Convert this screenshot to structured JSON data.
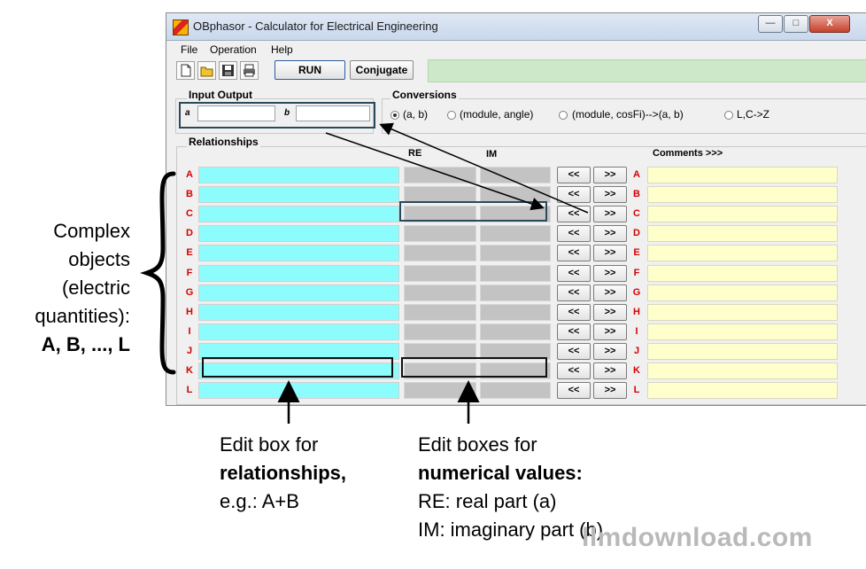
{
  "window": {
    "title": "OBphasor - Calculator for Electrical Engineering",
    "controls": {
      "minimize": "—",
      "maximize": "□",
      "close": "X"
    }
  },
  "menu": [
    "File",
    "Operation",
    "Help"
  ],
  "toolbar": {
    "icons": [
      "new-file-icon",
      "open-folder-icon",
      "save-icon",
      "print-icon"
    ],
    "run_label": "RUN",
    "conjugate_label": "Conjugate"
  },
  "input_output": {
    "title": "Input Output",
    "a_tag": "a",
    "b_tag": "b",
    "a_value": "",
    "b_value": ""
  },
  "conversions": {
    "title": "Conversions",
    "options": [
      "(a, b)",
      "(module, angle)",
      "(module, cosFi)-->(a, b)",
      "L,C->Z"
    ],
    "selected": "(a, b)"
  },
  "relationships": {
    "title": "Relationships",
    "re_header": "RE",
    "im_header": "IM",
    "comments_header": "Comments >>>",
    "left_button": "<<",
    "right_button": ">>",
    "rows": [
      "A",
      "B",
      "C",
      "D",
      "E",
      "F",
      "G",
      "H",
      "I",
      "J",
      "K",
      "L"
    ]
  },
  "annotations": {
    "left_lines": [
      "Complex",
      "objects",
      "(electric",
      "quantities):",
      "A, B, ..., L"
    ],
    "bottom_left_lines": [
      "Edit box for",
      "relationships,",
      "e.g.: A+B"
    ],
    "bottom_right_lines": [
      "Edit boxes for",
      "numerical values:",
      "RE: real part (a)",
      "IM: imaginary part (b)"
    ]
  },
  "watermark": "llmdownload.com",
  "colors": {
    "relationship_box": "#8cfcfc",
    "numeric_box": "#c3c3c3",
    "comment_box": "#ffffcc",
    "row_letter": "#d40000",
    "status_bar": "#cde8c8"
  }
}
